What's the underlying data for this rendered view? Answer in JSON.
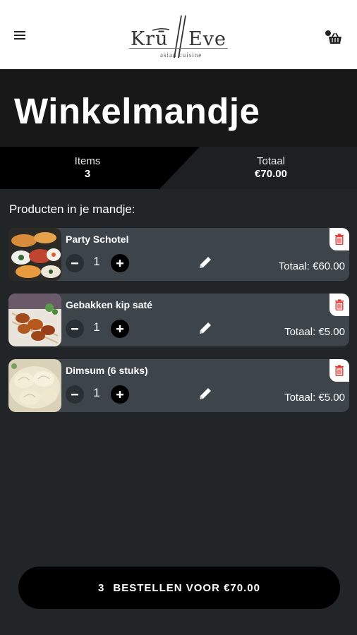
{
  "header": {
    "logo_text_left": "Krū",
    "logo_text_right": "Eve",
    "logo_subtitle": "asian  cuisine",
    "menu_icon": "hamburger-menu-icon",
    "cart_icon": "shopping-basket-icon"
  },
  "page": {
    "title": "Winkelmandje"
  },
  "summary": {
    "items_label": "Items",
    "items_value": "3",
    "total_label": "Totaal",
    "total_value": "€70.00"
  },
  "cart": {
    "section_label": "Producten in je mandje:",
    "items": [
      {
        "name": "Party Schotel",
        "quantity": "1",
        "total": "Totaal: €60.00",
        "image": "sushi-platter"
      },
      {
        "name": "Gebakken kip saté",
        "quantity": "1",
        "total": "Totaal: €5.00",
        "image": "chicken-skewers"
      },
      {
        "name": "Dimsum (6 stuks)",
        "quantity": "1",
        "total": "Totaal: €5.00",
        "image": "dumplings"
      }
    ]
  },
  "order_button": {
    "count": "3",
    "label": "BESTELLEN VOOR €70.00"
  },
  "colors": {
    "background": "#222527",
    "card": "#3d454b",
    "header": "#ffffff",
    "delete_icon": "#e53935",
    "button": "#000000"
  }
}
